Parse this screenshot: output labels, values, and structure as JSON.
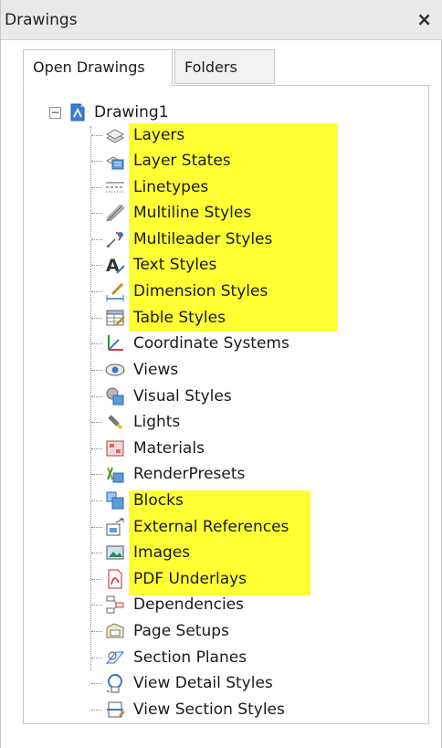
{
  "panel": {
    "title": "Drawings",
    "close": "×"
  },
  "tabs": [
    "Open Drawings",
    "Folders"
  ],
  "tree": {
    "root": {
      "label": "Drawing1",
      "expander": "−"
    },
    "items": [
      {
        "label": "Layers",
        "icon": "layers-icon",
        "highlighted": true
      },
      {
        "label": "Layer States",
        "icon": "layer-states-icon",
        "highlighted": true
      },
      {
        "label": "Linetypes",
        "icon": "linetypes-icon",
        "highlighted": true
      },
      {
        "label": "Multiline Styles",
        "icon": "multiline-styles-icon",
        "highlighted": true
      },
      {
        "label": "Multileader Styles",
        "icon": "multileader-styles-icon",
        "highlighted": true
      },
      {
        "label": "Text Styles",
        "icon": "text-styles-icon",
        "highlighted": true
      },
      {
        "label": "Dimension Styles",
        "icon": "dimension-styles-icon",
        "highlighted": true
      },
      {
        "label": "Table Styles",
        "icon": "table-styles-icon",
        "highlighted": true
      },
      {
        "label": "Coordinate Systems",
        "icon": "coordinate-systems-icon",
        "highlighted": false
      },
      {
        "label": "Views",
        "icon": "views-icon",
        "highlighted": false
      },
      {
        "label": "Visual Styles",
        "icon": "visual-styles-icon",
        "highlighted": false
      },
      {
        "label": "Lights",
        "icon": "lights-icon",
        "highlighted": false
      },
      {
        "label": "Materials",
        "icon": "materials-icon",
        "highlighted": false
      },
      {
        "label": "RenderPresets",
        "icon": "render-presets-icon",
        "highlighted": false
      },
      {
        "label": "Blocks",
        "icon": "blocks-icon",
        "highlighted": true
      },
      {
        "label": "External References",
        "icon": "external-references-icon",
        "highlighted": true
      },
      {
        "label": "Images",
        "icon": "images-icon",
        "highlighted": true
      },
      {
        "label": "PDF Underlays",
        "icon": "pdf-underlays-icon",
        "highlighted": true
      },
      {
        "label": "Dependencies",
        "icon": "dependencies-icon",
        "highlighted": false
      },
      {
        "label": "Page Setups",
        "icon": "page-setups-icon",
        "highlighted": false
      },
      {
        "label": "Section Planes",
        "icon": "section-planes-icon",
        "highlighted": false
      },
      {
        "label": "View Detail Styles",
        "icon": "view-detail-styles-icon",
        "highlighted": false
      },
      {
        "label": "View Section Styles",
        "icon": "view-section-styles-icon",
        "highlighted": false
      }
    ]
  },
  "colors": {
    "highlight": "#ffff33",
    "titlebar": "#e9e9eb"
  }
}
